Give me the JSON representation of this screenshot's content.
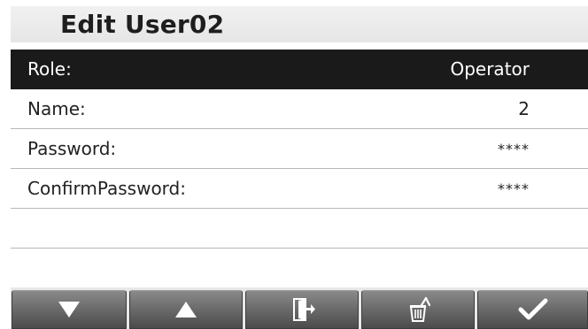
{
  "header": {
    "title": "Edit User02"
  },
  "fields": [
    {
      "label": "Role:",
      "value": "Operator",
      "selected": true
    },
    {
      "label": "Name:",
      "value": "2",
      "selected": false
    },
    {
      "label": "Password:",
      "value": "****",
      "selected": false
    },
    {
      "label": "ConfirmPassword:",
      "value": "****",
      "selected": false
    },
    {
      "label": "",
      "value": "",
      "selected": false
    },
    {
      "label": "",
      "value": "",
      "selected": false
    }
  ],
  "toolbar": {
    "buttons": [
      {
        "icon": "arrow-down-icon"
      },
      {
        "icon": "arrow-up-icon"
      },
      {
        "icon": "exit-icon"
      },
      {
        "icon": "delete-icon"
      },
      {
        "icon": "checkmark-icon"
      }
    ]
  },
  "colors": {
    "selected_row_bg": "#1a1a1a",
    "selected_row_text": "#ffffff",
    "text": "#222222",
    "divider": "#b7b7b7",
    "title_bar_bg": "#eeeeee",
    "button_bg": "#6d6d6d"
  }
}
